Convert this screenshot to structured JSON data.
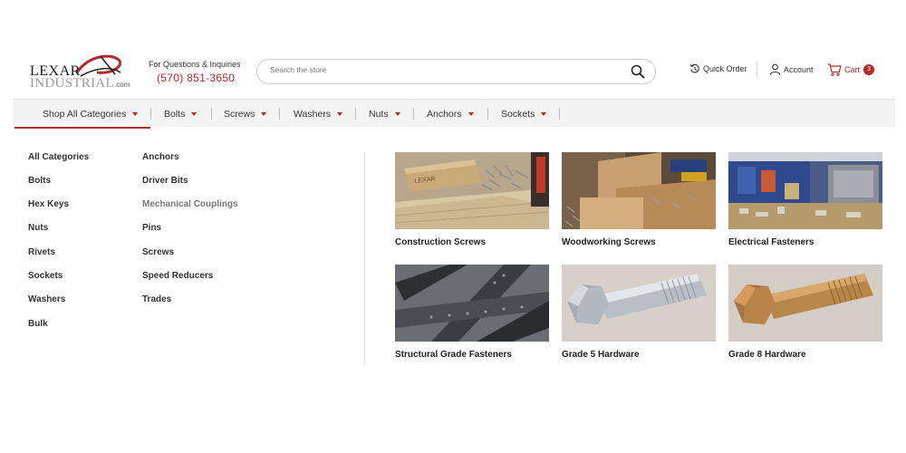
{
  "logo": {
    "line1": "LEXAR",
    "line2": "INDUSTRIAL",
    "suffix": ".com"
  },
  "contact": {
    "label": "For Questions & Inquiries",
    "phone": "(570) 851-3650"
  },
  "search": {
    "placeholder": "Search the store"
  },
  "header_links": {
    "quick_order": "Quick Order",
    "account": "Account",
    "cart": "Cart",
    "cart_count": "3"
  },
  "nav": {
    "items": [
      {
        "label": "Shop All Categories"
      },
      {
        "label": "Bolts"
      },
      {
        "label": "Screws"
      },
      {
        "label": "Washers"
      },
      {
        "label": "Nuts"
      },
      {
        "label": "Anchors"
      },
      {
        "label": "Sockets"
      }
    ]
  },
  "menu": {
    "col1": [
      "All Categories",
      "Bolts",
      "Hex Keys",
      "Nuts",
      "Rivets",
      "Sockets",
      "Washers",
      "Bulk"
    ],
    "col2": [
      "Anchors",
      "Driver Bits",
      "Mechanical Couplings",
      "Pins",
      "Screws",
      "Speed Reducers",
      "Trades"
    ]
  },
  "tiles": [
    {
      "caption": "Construction Screws",
      "image_text": "LEXAR"
    },
    {
      "caption": "Woodworking Screws"
    },
    {
      "caption": "Electrical Fasteners"
    },
    {
      "caption": "Structural Grade Fasteners"
    },
    {
      "caption": "Grade 5 Hardware"
    },
    {
      "caption": "Grade 8 Hardware"
    }
  ],
  "colors": {
    "accent": "#b52a2a",
    "nav_bg": "#f4f4f4"
  }
}
